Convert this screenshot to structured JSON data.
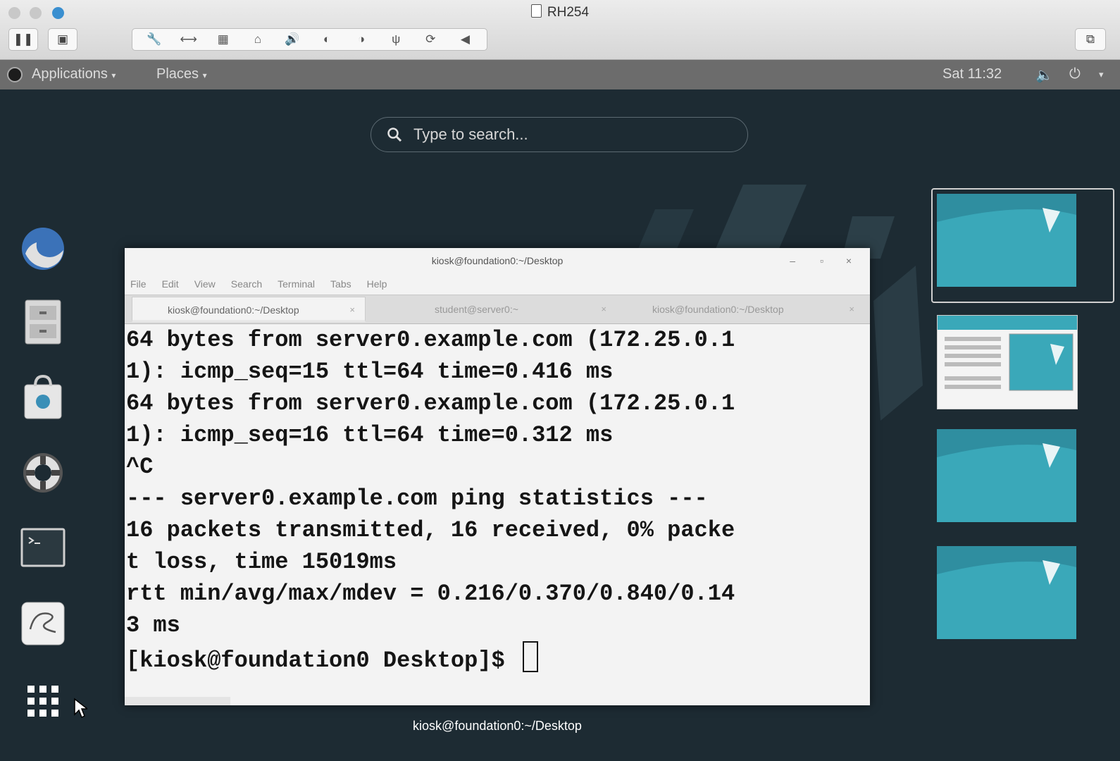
{
  "vm_window": {
    "title": "RH254"
  },
  "topbar": {
    "applications": "Applications",
    "places": "Places",
    "clock": "Sat 11:32"
  },
  "overview": {
    "search_placeholder": "Type to search..."
  },
  "dash": {
    "items": [
      "firefox-icon",
      "files-icon",
      "software-icon",
      "help-icon",
      "terminal-icon",
      "screenshot-app-icon",
      "show-applications-icon"
    ]
  },
  "terminal": {
    "title": "kiosk@foundation0:~/Desktop",
    "menu": [
      "File",
      "Edit",
      "View",
      "Search",
      "Terminal",
      "Tabs",
      "Help"
    ],
    "tabs": [
      {
        "label": "kiosk@foundation0:~/Desktop",
        "close": "×"
      },
      {
        "label": "student@server0:~",
        "close": "×"
      },
      {
        "label": "kiosk@foundation0:~/Desktop",
        "close": "×"
      }
    ],
    "lines": [
      "64 bytes from server0.example.com (172.25.0.1",
      "1): icmp_seq=15 ttl=64 time=0.416 ms",
      "64 bytes from server0.example.com (172.25.0.1",
      "1): icmp_seq=16 ttl=64 time=0.312 ms",
      "^C",
      "--- server0.example.com ping statistics ---",
      "16 packets transmitted, 16 received, 0% packe",
      "t loss, time 15019ms",
      "rtt min/avg/max/mdev = 0.216/0.370/0.840/0.14",
      "3 ms"
    ],
    "prompt": "[kiosk@foundation0 Desktop]$"
  },
  "window_caption": "kiosk@foundation0:~/Desktop",
  "colors": {
    "overview_bg": "#1d2b33",
    "workspace_blue": "#3aa8b9",
    "topbar_gray": "#6c6c6c"
  }
}
